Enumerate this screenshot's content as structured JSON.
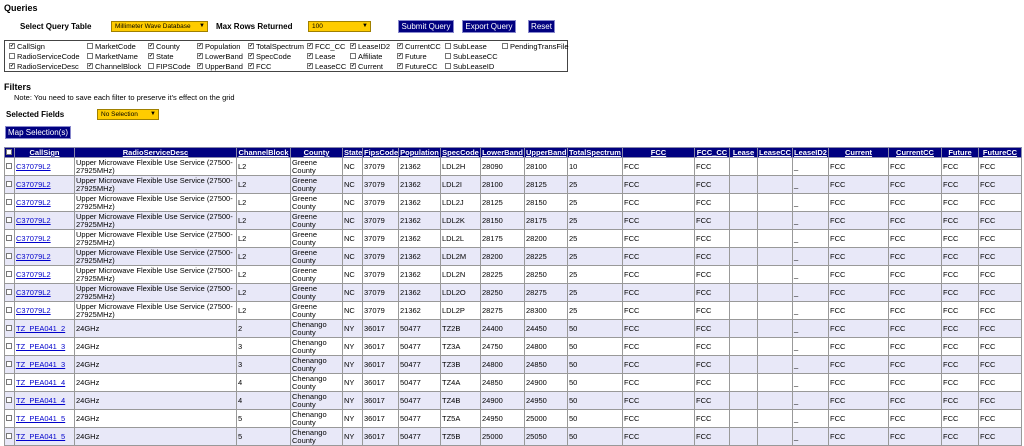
{
  "queries": {
    "title": "Queries",
    "select_label": "Select Query Table",
    "table_value": "Millimeter Wave Database",
    "max_label": "Max Rows Returned",
    "max_value": "100",
    "submit": "Submit Query",
    "export": "Export Query",
    "reset": "Reset"
  },
  "fields": [
    [
      {
        "l": "CallSign",
        "c": true
      },
      {
        "l": "MarketCode",
        "c": false
      },
      {
        "l": "County",
        "c": true
      },
      {
        "l": "Population",
        "c": true
      },
      {
        "l": "TotalSpectrum",
        "c": true
      },
      {
        "l": "FCC_CC",
        "c": true
      },
      {
        "l": "LeaseID2",
        "c": true
      },
      {
        "l": "CurrentCC",
        "c": true
      },
      {
        "l": "SubLease",
        "c": false
      },
      {
        "l": "PendingTransFile",
        "c": false
      }
    ],
    [
      {
        "l": "RadioServiceCode",
        "c": false
      },
      {
        "l": "MarketName",
        "c": false
      },
      {
        "l": "State",
        "c": true
      },
      {
        "l": "LowerBand",
        "c": true
      },
      {
        "l": "SpecCode",
        "c": true
      },
      {
        "l": "Lease",
        "c": true
      },
      {
        "l": "Affiliate",
        "c": false
      },
      {
        "l": "Future",
        "c": true
      },
      {
        "l": "SubLeaseCC",
        "c": false
      }
    ],
    [
      {
        "l": "RadioServiceDesc",
        "c": true
      },
      {
        "l": "ChannelBlock",
        "c": true
      },
      {
        "l": "FIPSCode",
        "c": false
      },
      {
        "l": "UpperBand",
        "c": true
      },
      {
        "l": "FCC",
        "c": true
      },
      {
        "l": "LeaseCC",
        "c": true
      },
      {
        "l": "Current",
        "c": true
      },
      {
        "l": "FutureCC",
        "c": true
      },
      {
        "l": "SubLeaseID",
        "c": false
      }
    ]
  ],
  "filters": {
    "title": "Filters",
    "note": "Note: You need to save each filter to preserve it's effect on the grid",
    "selected_label": "Selected Fields",
    "selected_value": "No Selection",
    "map_button": "Map Selection(s)"
  },
  "grid": {
    "columns": [
      "CallSign",
      "RadioServiceDesc",
      "ChannelBlock",
      "County",
      "State",
      "FipsCode",
      "Population",
      "SpecCode",
      "LowerBand",
      "UpperBand",
      "TotalSpectrum",
      "FCC",
      "FCC_CC",
      "Lease",
      "LeaseCC",
      "LeaseID2",
      "Current",
      "CurrentCC",
      "Future",
      "FutureCC"
    ],
    "rows": [
      [
        "C37079L2",
        "Upper Microwave Flexible Use Service (27500-27925MHz)",
        "L2",
        "Greene County",
        "NC",
        "37079",
        "21362",
        "LDL2H",
        "28090",
        "28100",
        "10",
        "FCC",
        "FCC",
        "",
        "",
        "_",
        "FCC",
        "FCC",
        "FCC",
        "FCC"
      ],
      [
        "C37079L2",
        "Upper Microwave Flexible Use Service (27500-27925MHz)",
        "L2",
        "Greene County",
        "NC",
        "37079",
        "21362",
        "LDL2I",
        "28100",
        "28125",
        "25",
        "FCC",
        "FCC",
        "",
        "",
        "_",
        "FCC",
        "FCC",
        "FCC",
        "FCC"
      ],
      [
        "C37079L2",
        "Upper Microwave Flexible Use Service (27500-27925MHz)",
        "L2",
        "Greene County",
        "NC",
        "37079",
        "21362",
        "LDL2J",
        "28125",
        "28150",
        "25",
        "FCC",
        "FCC",
        "",
        "",
        "_",
        "FCC",
        "FCC",
        "FCC",
        "FCC"
      ],
      [
        "C37079L2",
        "Upper Microwave Flexible Use Service (27500-27925MHz)",
        "L2",
        "Greene County",
        "NC",
        "37079",
        "21362",
        "LDL2K",
        "28150",
        "28175",
        "25",
        "FCC",
        "FCC",
        "",
        "",
        "_",
        "FCC",
        "FCC",
        "FCC",
        "FCC"
      ],
      [
        "C37079L2",
        "Upper Microwave Flexible Use Service (27500-27925MHz)",
        "L2",
        "Greene County",
        "NC",
        "37079",
        "21362",
        "LDL2L",
        "28175",
        "28200",
        "25",
        "FCC",
        "FCC",
        "",
        "",
        "_",
        "FCC",
        "FCC",
        "FCC",
        "FCC"
      ],
      [
        "C37079L2",
        "Upper Microwave Flexible Use Service (27500-27925MHz)",
        "L2",
        "Greene County",
        "NC",
        "37079",
        "21362",
        "LDL2M",
        "28200",
        "28225",
        "25",
        "FCC",
        "FCC",
        "",
        "",
        "_",
        "FCC",
        "FCC",
        "FCC",
        "FCC"
      ],
      [
        "C37079L2",
        "Upper Microwave Flexible Use Service (27500-27925MHz)",
        "L2",
        "Greene County",
        "NC",
        "37079",
        "21362",
        "LDL2N",
        "28225",
        "28250",
        "25",
        "FCC",
        "FCC",
        "",
        "",
        "_",
        "FCC",
        "FCC",
        "FCC",
        "FCC"
      ],
      [
        "C37079L2",
        "Upper Microwave Flexible Use Service (27500-27925MHz)",
        "L2",
        "Greene County",
        "NC",
        "37079",
        "21362",
        "LDL2O",
        "28250",
        "28275",
        "25",
        "FCC",
        "FCC",
        "",
        "",
        "_",
        "FCC",
        "FCC",
        "FCC",
        "FCC"
      ],
      [
        "C37079L2",
        "Upper Microwave Flexible Use Service (27500-27925MHz)",
        "L2",
        "Greene County",
        "NC",
        "37079",
        "21362",
        "LDL2P",
        "28275",
        "28300",
        "25",
        "FCC",
        "FCC",
        "",
        "",
        "_",
        "FCC",
        "FCC",
        "FCC",
        "FCC"
      ],
      [
        "TZ_PEA041_2",
        "24GHz",
        "2",
        "Chenango County",
        "NY",
        "36017",
        "50477",
        "TZ2B",
        "24400",
        "24450",
        "50",
        "FCC",
        "FCC",
        "",
        "",
        "_",
        "FCC",
        "FCC",
        "FCC",
        "FCC"
      ],
      [
        "TZ_PEA041_3",
        "24GHz",
        "3",
        "Chenango County",
        "NY",
        "36017",
        "50477",
        "TZ3A",
        "24750",
        "24800",
        "50",
        "FCC",
        "FCC",
        "",
        "",
        "_",
        "FCC",
        "FCC",
        "FCC",
        "FCC"
      ],
      [
        "TZ_PEA041_3",
        "24GHz",
        "3",
        "Chenango County",
        "NY",
        "36017",
        "50477",
        "TZ3B",
        "24800",
        "24850",
        "50",
        "FCC",
        "FCC",
        "",
        "",
        "_",
        "FCC",
        "FCC",
        "FCC",
        "FCC"
      ],
      [
        "TZ_PEA041_4",
        "24GHz",
        "4",
        "Chenango County",
        "NY",
        "36017",
        "50477",
        "TZ4A",
        "24850",
        "24900",
        "50",
        "FCC",
        "FCC",
        "",
        "",
        "_",
        "FCC",
        "FCC",
        "FCC",
        "FCC"
      ],
      [
        "TZ_PEA041_4",
        "24GHz",
        "4",
        "Chenango County",
        "NY",
        "36017",
        "50477",
        "TZ4B",
        "24900",
        "24950",
        "50",
        "FCC",
        "FCC",
        "",
        "",
        "_",
        "FCC",
        "FCC",
        "FCC",
        "FCC"
      ],
      [
        "TZ_PEA041_5",
        "24GHz",
        "5",
        "Chenango County",
        "NY",
        "36017",
        "50477",
        "TZ5A",
        "24950",
        "25000",
        "50",
        "FCC",
        "FCC",
        "",
        "",
        "_",
        "FCC",
        "FCC",
        "FCC",
        "FCC"
      ],
      [
        "TZ_PEA041_5",
        "24GHz",
        "5",
        "Chenango County",
        "NY",
        "36017",
        "50477",
        "TZ5B",
        "25000",
        "25050",
        "50",
        "FCC",
        "FCC",
        "",
        "",
        "_",
        "FCC",
        "FCC",
        "FCC",
        "FCC"
      ]
    ]
  }
}
